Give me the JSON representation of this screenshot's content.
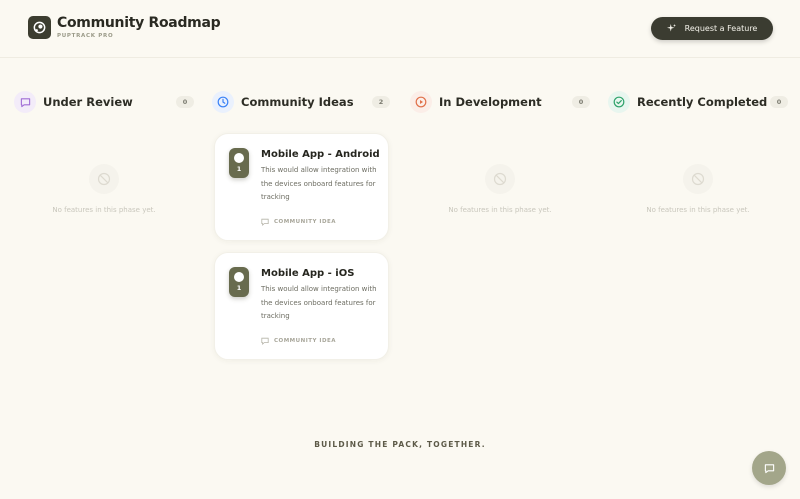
{
  "header": {
    "title": "Community Roadmap",
    "subtitle": "PUPTRACK PRO",
    "request_button": "Request a Feature"
  },
  "columns": [
    {
      "title": "Under Review",
      "count": "0",
      "icon": "speech-bubble-icon",
      "color": "#a06cd5",
      "empty_text": "No features in this phase yet."
    },
    {
      "title": "Community Ideas",
      "count": "2",
      "icon": "clock-icon",
      "color": "#3b82f6"
    },
    {
      "title": "In Development",
      "count": "0",
      "icon": "play-circle-icon",
      "color": "#e0704a",
      "empty_text": "No features in this phase yet."
    },
    {
      "title": "Recently Completed",
      "count": "0",
      "icon": "check-circle-icon",
      "color": "#2fa36b",
      "empty_text": "No features in this phase yet."
    }
  ],
  "cards": [
    {
      "votes": "1",
      "title": "Mobile App - Android",
      "description": "This would allow integration with the devices onboard features for tracking",
      "tag": "COMMUNITY IDEA"
    },
    {
      "votes": "1",
      "title": "Mobile App - iOS",
      "description": "This would allow integration with the devices onboard features for tracking",
      "tag": "COMMUNITY IDEA"
    }
  ],
  "footer": {
    "tagline": "BUILDING THE PACK, TOGETHER."
  },
  "colors": {
    "accent_dark": "#3b3c31",
    "vote_green": "#686b4e",
    "background": "#fbf9f2",
    "chat_button": "#a3a68a"
  }
}
